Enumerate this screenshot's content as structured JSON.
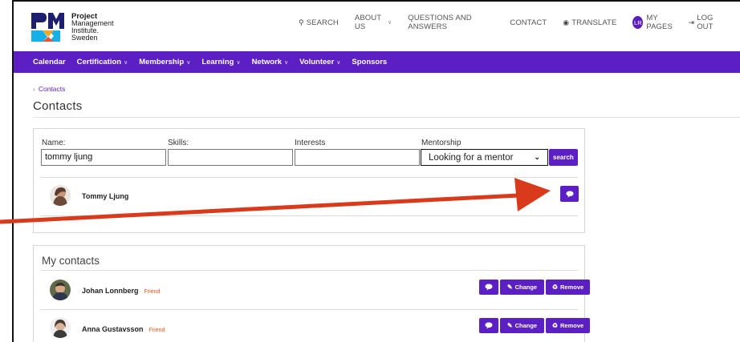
{
  "logo": {
    "line1": "Project",
    "line2": "Management",
    "line3": "Institute.",
    "line4": "Sweden"
  },
  "topnav": {
    "search": "SEARCH",
    "about": "ABOUT US",
    "qa": "QUESTIONS AND ANSWERS",
    "contact": "CONTACT",
    "translate": "TRANSLATE",
    "avatar_initials": "LR",
    "my_pages": "MY PAGES",
    "logout": "LOG OUT"
  },
  "mainnav": [
    "Calendar",
    "Certification",
    "Membership",
    "Learning",
    "Network",
    "Volunteer",
    "Sponsors"
  ],
  "breadcrumb": "Contacts",
  "page_title": "Contacts",
  "search_form": {
    "name_label": "Name:",
    "name_value": "tommy ljung",
    "skills_label": "Skills:",
    "skills_value": "",
    "interests_label": "Interests",
    "interests_value": "",
    "mentorship_label": "Mentorship",
    "mentorship_value": "Looking for a mentor",
    "search_label": "search"
  },
  "result": {
    "name": "Tommy Ljung"
  },
  "my_contacts": {
    "title": "My contacts",
    "items": [
      {
        "name": "Johan Lonnberg",
        "tag": "Friend"
      },
      {
        "name": "Anna Gustavsson",
        "tag": "Friend"
      }
    ],
    "change_label": "Change",
    "remove_label": "Remove"
  },
  "colors": {
    "brand_purple": "#5c1fc4",
    "friend_tag": "#e05a1a",
    "arrow_red": "#d93a1c"
  }
}
